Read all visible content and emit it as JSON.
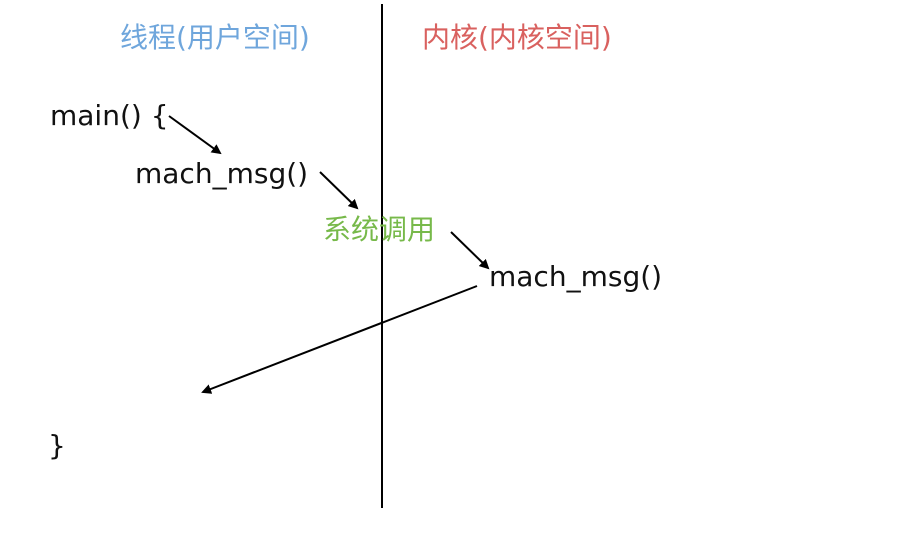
{
  "headers": {
    "user_space": "线程(用户空间)",
    "kernel_space": "内核(内核空间)"
  },
  "code": {
    "main_open": "main() {",
    "user_call": "mach_msg()",
    "syscall": "系统调用",
    "kernel_call": "mach_msg()",
    "main_close": "}"
  },
  "colors": {
    "user_header": "#6fa6dc",
    "kernel_header": "#d9615f",
    "syscall": "#77b94a",
    "text": "#111111",
    "line": "#000000"
  }
}
